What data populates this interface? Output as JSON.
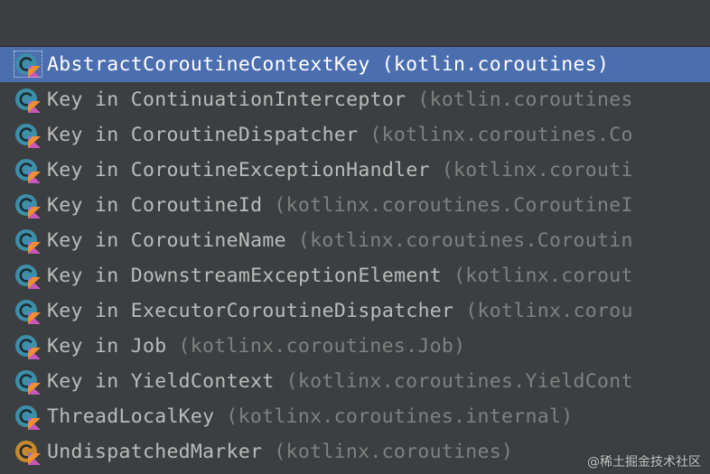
{
  "colors": {
    "background": "#3c3f41",
    "selection": "#4b6eaf",
    "text": "#bbbbbb",
    "package_text": "#808080",
    "class_icon": "#3d8ea8",
    "object_icon": "#c5892e"
  },
  "completion": {
    "items": [
      {
        "name": "AbstractCoroutineContextKey",
        "package": "(kotlin.coroutines)",
        "icon": "kotlin-class-icon",
        "selected": true
      },
      {
        "name": "Key in ContinuationInterceptor",
        "package": "(kotlin.coroutines",
        "icon": "kotlin-class-icon"
      },
      {
        "name": "Key in CoroutineDispatcher",
        "package": "(kotlinx.coroutines.Co",
        "icon": "kotlin-class-icon"
      },
      {
        "name": "Key in CoroutineExceptionHandler",
        "package": "(kotlinx.corouti",
        "icon": "kotlin-class-icon"
      },
      {
        "name": "Key in CoroutineId",
        "package": "(kotlinx.coroutines.CoroutineI",
        "icon": "kotlin-class-icon"
      },
      {
        "name": "Key in CoroutineName",
        "package": "(kotlinx.coroutines.Coroutin",
        "icon": "kotlin-class-icon"
      },
      {
        "name": "Key in DownstreamExceptionElement",
        "package": "(kotlinx.corout",
        "icon": "kotlin-class-icon"
      },
      {
        "name": "Key in ExecutorCoroutineDispatcher",
        "package": "(kotlinx.corou",
        "icon": "kotlin-class-icon"
      },
      {
        "name": "Key in Job",
        "package": "(kotlinx.coroutines.Job)",
        "icon": "kotlin-class-icon"
      },
      {
        "name": "Key in YieldContext",
        "package": "(kotlinx.coroutines.YieldCont",
        "icon": "kotlin-class-icon"
      },
      {
        "name": "ThreadLocalKey",
        "package": "(kotlinx.coroutines.internal)",
        "icon": "kotlin-class-icon"
      },
      {
        "name": "UndispatchedMarker",
        "package": "(kotlinx.coroutines)",
        "icon": "kotlin-object-icon"
      }
    ]
  },
  "watermark": "@稀土掘金技术社区"
}
